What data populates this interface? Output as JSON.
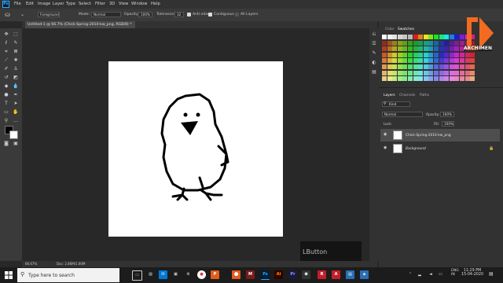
{
  "menubar": {
    "logo": "Ps",
    "items": [
      "File",
      "Edit",
      "Image",
      "Layer",
      "Type",
      "Select",
      "Filter",
      "3D",
      "View",
      "Window",
      "Help"
    ]
  },
  "options": {
    "foreground_label": "Foreground",
    "mode_label": "Mode:",
    "mode_value": "Normal",
    "opacity_label": "Opacity:",
    "opacity_value": "100%",
    "tolerance_label": "Tolerance:",
    "tolerance_value": "32",
    "antialias_label": "Anti-alias",
    "contiguous_label": "Contiguous",
    "all_layers_label": "All Layers"
  },
  "document": {
    "tab_title": "Untitled-1 @ 66.7% (Chick-Spring-2010-kw_png, RGB/8) *",
    "zoom": "66.67%",
    "doc_size": "Doc: 2.86M/1.60M"
  },
  "overlay": {
    "lbutton": "LButton"
  },
  "panels": {
    "color_tab": "Color",
    "swatches_tab": "Swatches",
    "layers_tab": "Layers",
    "channels_tab": "Channels",
    "paths_tab": "Paths",
    "kind_label": "Kind",
    "blend_value": "Normal",
    "opacity_label": "Opacity:",
    "opacity_value": "100%",
    "lock_label": "Lock:",
    "fill_label": "Fill:",
    "fill_value": "100%",
    "layers": [
      {
        "name": "Chick-Spring-2010-kw_png"
      },
      {
        "name": "Background"
      }
    ]
  },
  "watermark": {
    "brand": "ARCHIMEN"
  },
  "taskbar": {
    "search_placeholder": "Type here to search",
    "lang": "ENG",
    "region": "IN",
    "time": "11:29 PM",
    "date": "15-04-2020"
  },
  "colors": {
    "accent_orange": "#f26b21",
    "ps_blue": "#31a8ff"
  }
}
